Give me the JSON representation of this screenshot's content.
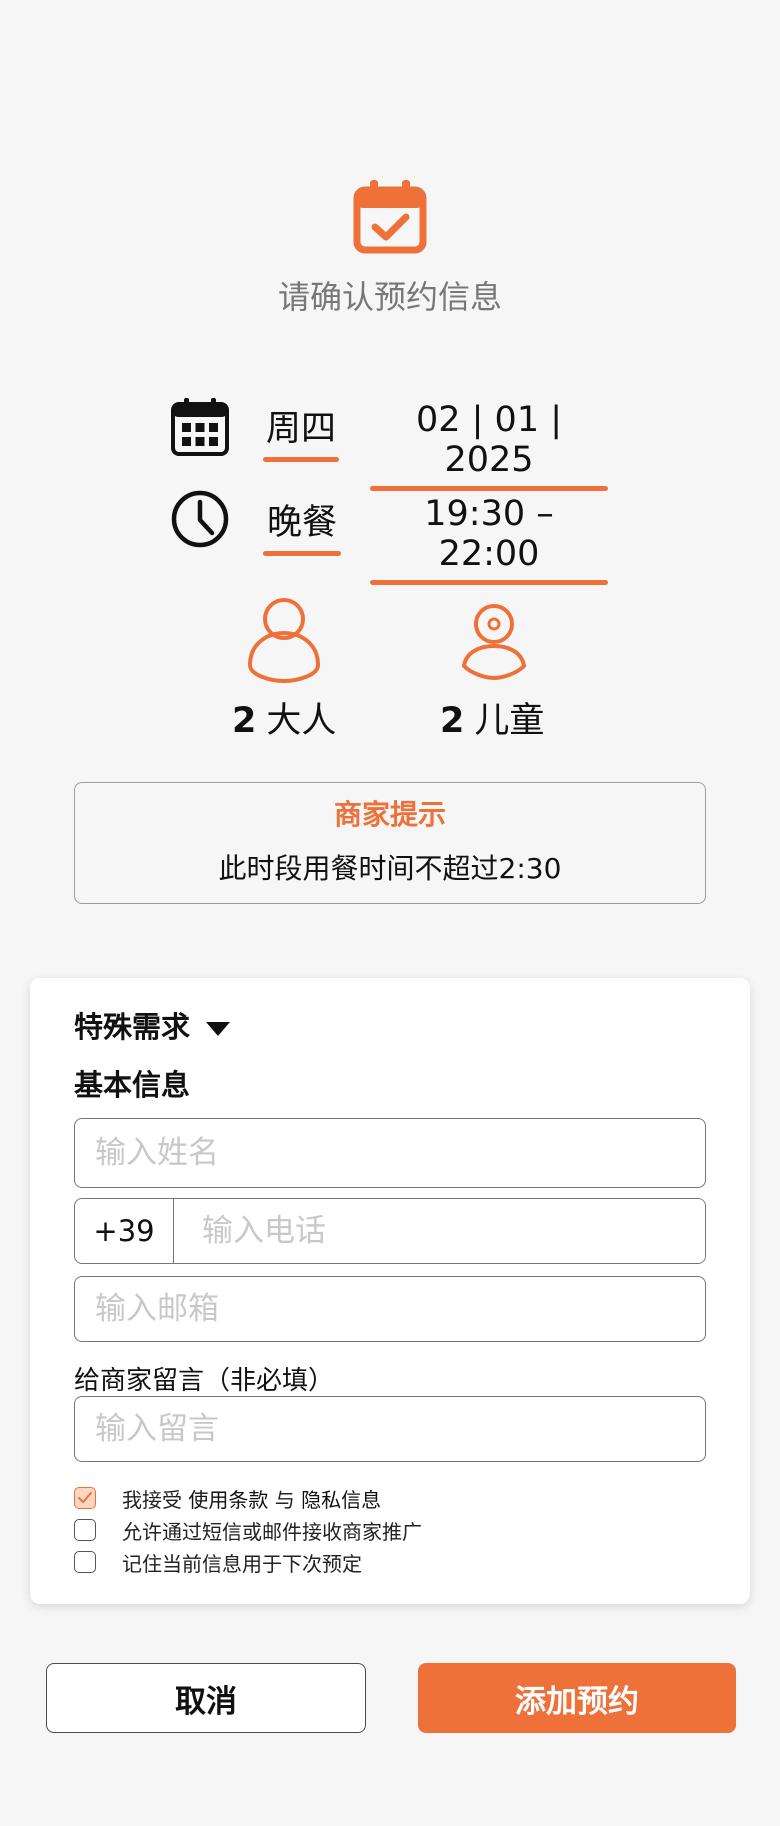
{
  "header": {
    "title": "请确认预约信息",
    "icon": "calendar-check-icon"
  },
  "booking": {
    "weekday": "周四",
    "date": "02 | 01 | 2025",
    "meal": "晚餐",
    "time": "19:30 – 22:00"
  },
  "guests": {
    "adults_count": "2",
    "adults_label": "大人",
    "children_count": "2",
    "children_label": "儿童"
  },
  "tip": {
    "title": "商家提示",
    "text": "此时段用餐时间不超过2:30"
  },
  "form": {
    "special_requests": "特殊需求",
    "basic_info": "基本信息",
    "name_placeholder": "输入姓名",
    "phone_code": "+39",
    "phone_placeholder": "输入电话",
    "email_placeholder": "输入邮箱",
    "message_label": "给商家留言（非必填）",
    "message_placeholder": "输入留言"
  },
  "consents": {
    "terms_prefix": "我接受",
    "terms_link": "使用条款",
    "terms_and": "与",
    "privacy_link": "隐私信息",
    "terms_checked": true,
    "promo": "允许通过短信或邮件接收商家推广",
    "promo_checked": false,
    "remember": "记住当前信息用于下次预定",
    "remember_checked": false
  },
  "buttons": {
    "cancel": "取消",
    "add": "添加预约"
  },
  "colors": {
    "accent": "#ee7139",
    "background": "#f6f6f6"
  }
}
